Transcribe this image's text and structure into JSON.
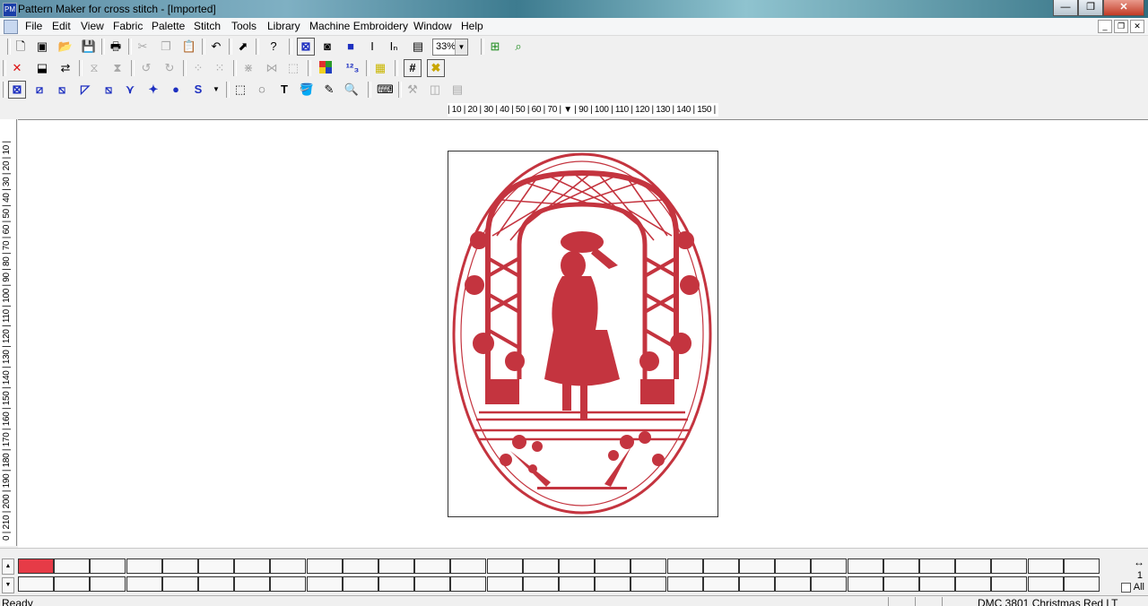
{
  "window": {
    "title": "Pattern Maker for cross stitch - [Imported]",
    "app_icon": "PM",
    "minimize": "—",
    "restore": "❐",
    "close": "✕"
  },
  "menu": {
    "items": [
      "File",
      "Edit",
      "View",
      "Fabric",
      "Palette",
      "Stitch",
      "Tools",
      "Library",
      "Machine Embroidery",
      "Window",
      "Help"
    ]
  },
  "toolbar": {
    "zoom": "33%"
  },
  "rulers": {
    "horizontal": "| 10 | 20 | 30 | 40 | 50 | 60 | 70 | ▼ | 90 | 100 | 110 | 120 | 130 | 140 | 150 | 16",
    "vertical": "0 | 210 | 200 | 190 | 180 | 170 | 160 | 150 | 140 | 130 | 120 | 110 | 100 | 90 | 80 | 70 | 60 | 50 | 40 | 30 | 20 | 10 |"
  },
  "pattern": {
    "thread_color": "#c4343f",
    "background": "#ffffff"
  },
  "palette": {
    "selected_color": "#e63b47",
    "page": "1",
    "all_label": "All",
    "nav_arrows": "↔"
  },
  "status": {
    "left": "Ready",
    "thread": "DMC 3801 Christmas Red LT"
  }
}
